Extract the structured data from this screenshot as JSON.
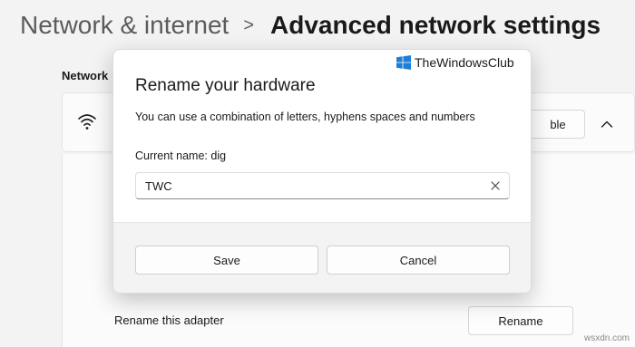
{
  "header": {
    "parent": "Network & internet",
    "separator": ">",
    "current": "Advanced network settings"
  },
  "section": {
    "title": "Network"
  },
  "adapter": {
    "icon": "wifi-icon",
    "disable_label": "ble",
    "expand_icon": "chevron-up-icon"
  },
  "rename_row": {
    "label": "Rename this adapter",
    "button_label": "Rename"
  },
  "dialog": {
    "title": "Rename your hardware",
    "description": "You can use a combination of letters, hyphens spaces and numbers",
    "current_name": "Current name: dig",
    "input_value": "TWC",
    "clear_icon": "close-icon",
    "save_label": "Save",
    "cancel_label": "Cancel"
  },
  "brand": {
    "text": "TheWindowsClub",
    "logo_color": "#1e7fd6"
  },
  "watermark": "wsxdn.com"
}
